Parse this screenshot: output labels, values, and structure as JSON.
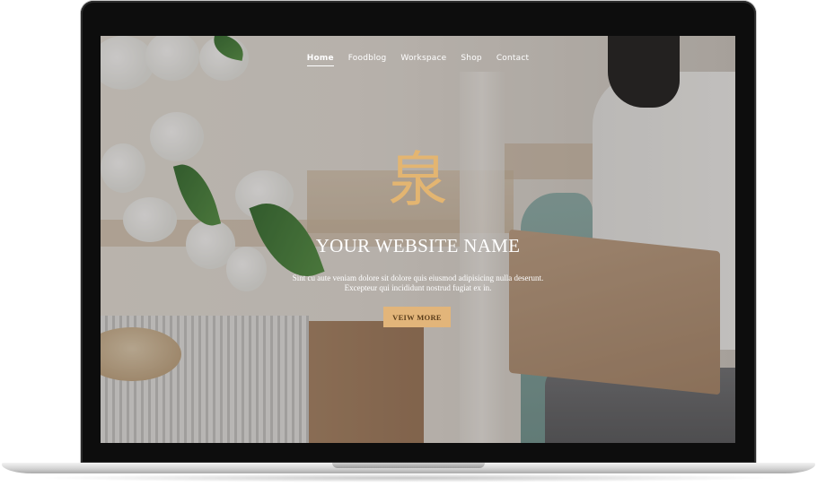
{
  "nav": {
    "items": [
      {
        "label": "Home",
        "active": true
      },
      {
        "label": "Foodblog",
        "active": false
      },
      {
        "label": "Workspace",
        "active": false
      },
      {
        "label": "Shop",
        "active": false
      },
      {
        "label": "Contact",
        "active": false
      }
    ]
  },
  "hero": {
    "logo_glyph": "泉",
    "site_name": "YOUR WEBSITE NAME",
    "tagline_line1": "Sint cu aute veniam dolore sit dolore quis eiusmod adipisicing nulla deserunt.",
    "tagline_line2": "Excepteur qui incididunt nostrud fugiat ex in.",
    "cta_label": "VEIW MORE"
  },
  "colors": {
    "accent": "#e2b57a",
    "logo": "#e3b571",
    "bezel": "#0d0d0d",
    "text": "#ffffff"
  }
}
